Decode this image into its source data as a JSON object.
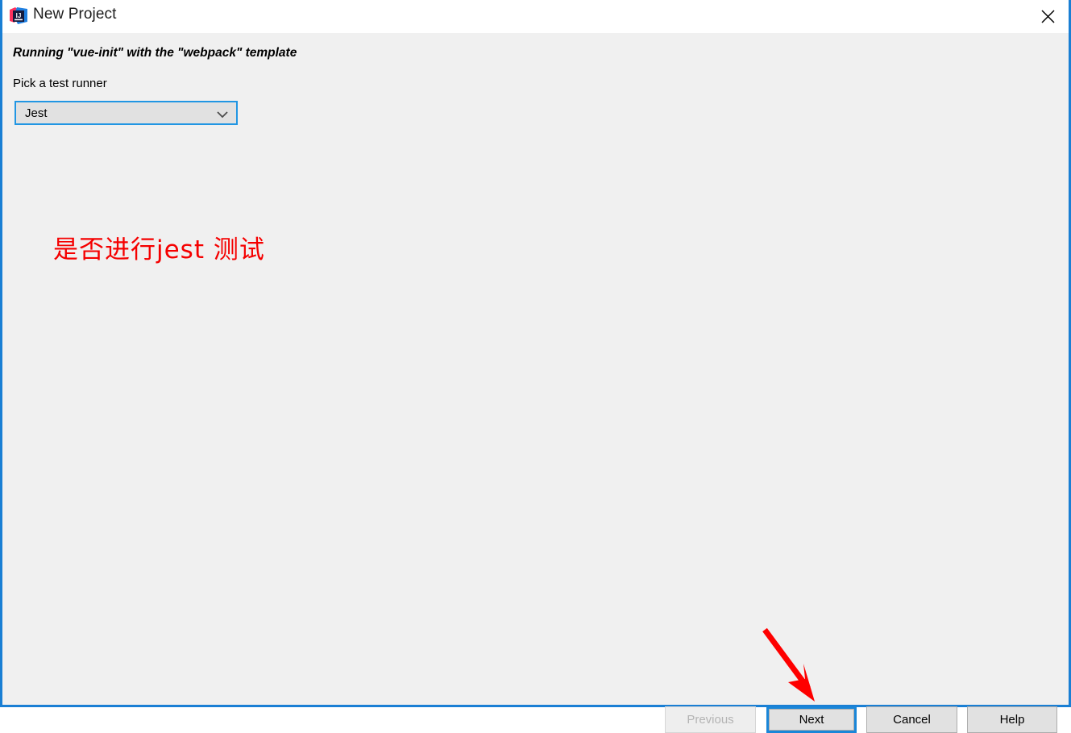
{
  "window": {
    "title": "New Project",
    "app_icon": "intellij-idea-icon",
    "border_color": "#1a7fd4",
    "titlebar_bg": "#ffffff",
    "content_bg": "#f0f0f0"
  },
  "titlebar": {
    "close_label": "close-icon"
  },
  "content": {
    "running_line": "Running \"vue-init\" with the \"webpack\" template",
    "pick_label": "Pick a test runner",
    "combo": {
      "name": "test-runner-select",
      "value": "Jest",
      "options": [
        "Jest"
      ],
      "focus_color": "#2196e3",
      "background": "#e1e1e1"
    }
  },
  "annotation": {
    "text": "是否进行jest 测试",
    "color": "#f50000",
    "arrow": "red-arrow-pointing-to-next-button"
  },
  "buttons": {
    "previous": {
      "label": "Previous",
      "enabled": false
    },
    "next": {
      "label": "Next",
      "enabled": true,
      "focused": true,
      "focus_color": "#1a86d8"
    },
    "cancel": {
      "label": "Cancel",
      "enabled": true
    },
    "help": {
      "label": "Help",
      "enabled": true
    }
  }
}
